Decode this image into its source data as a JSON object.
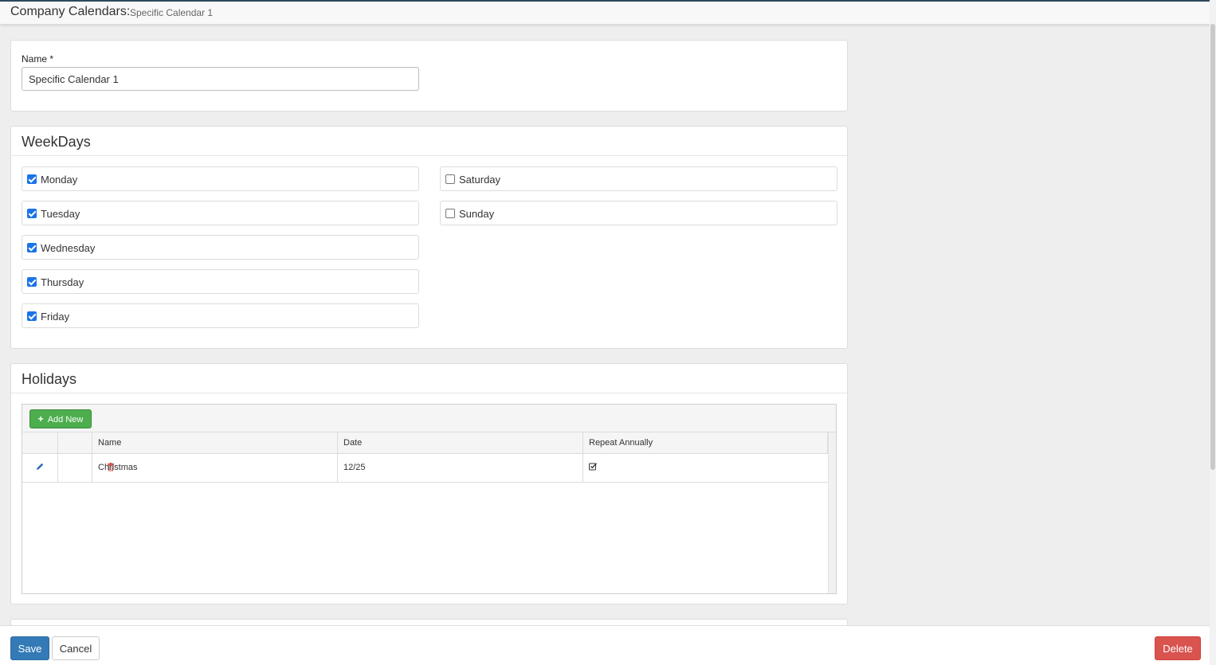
{
  "header": {
    "title": "Company Calendars:",
    "subtitle": "Specific Calendar 1"
  },
  "name_section": {
    "label": "Name *",
    "value": "Specific Calendar 1"
  },
  "weekdays": {
    "title": "WeekDays",
    "days": [
      {
        "label": "Monday",
        "checked": true
      },
      {
        "label": "Tuesday",
        "checked": true
      },
      {
        "label": "Wednesday",
        "checked": true
      },
      {
        "label": "Thursday",
        "checked": true
      },
      {
        "label": "Friday",
        "checked": true
      },
      {
        "label": "Saturday",
        "checked": false
      },
      {
        "label": "Sunday",
        "checked": false
      }
    ]
  },
  "holidays": {
    "title": "Holidays",
    "add_label": "Add New",
    "columns": [
      "Name",
      "Date",
      "Repeat Annually"
    ],
    "rows": [
      {
        "name": "Christmas",
        "date": "12/25",
        "repeat_annually": true
      }
    ]
  },
  "footer": {
    "save_label": "Save",
    "cancel_label": "Cancel",
    "delete_label": "Delete"
  },
  "colors": {
    "primary": "#337ab7",
    "success": "#4cae4c",
    "danger": "#d9534f",
    "checkbox": "#1a73e8"
  },
  "icons": {
    "edit": "pencil-icon",
    "delete": "trash-icon",
    "add": "plus-icon",
    "repeat": "checkbox-checked-icon"
  }
}
